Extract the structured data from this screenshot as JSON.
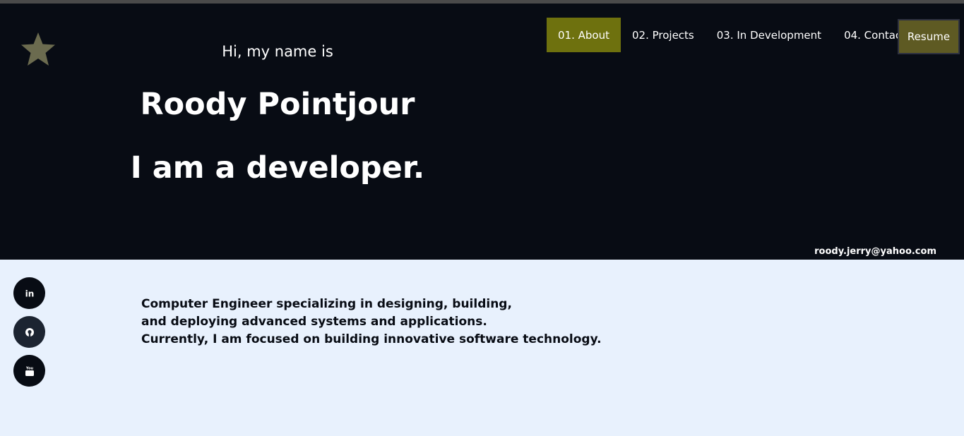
{
  "hero": {
    "greeting": "Hi, my name is",
    "name": "Roody Pointjour",
    "role": "I am a developer.",
    "email": "roody.jerry@yahoo.com"
  },
  "logo": {
    "icon": "star-icon",
    "color": "#6b6b4f"
  },
  "nav": {
    "items": [
      {
        "label": "01. About",
        "active": true
      },
      {
        "label": "02. Projects",
        "active": false
      },
      {
        "label": "03. In Development",
        "active": false
      },
      {
        "label": "04. Contact",
        "active": false
      }
    ],
    "resume_label": "Resume"
  },
  "social": [
    {
      "name": "linkedin",
      "icon": "linkedin-icon",
      "glyph": "in"
    },
    {
      "name": "github",
      "icon": "github-icon"
    },
    {
      "name": "youtube",
      "icon": "youtube-icon",
      "glyph": "You"
    }
  ],
  "bio": {
    "lines": [
      "Computer Engineer specializing in designing, building,",
      "and deploying advanced systems and applications.",
      "Currently, I am focused on building innovative software technology."
    ]
  },
  "colors": {
    "hero_bg": "#080c14",
    "page_bg": "#e8f1fd",
    "nav_active": "#6e710e",
    "resume_bg": "#5e5a23"
  }
}
